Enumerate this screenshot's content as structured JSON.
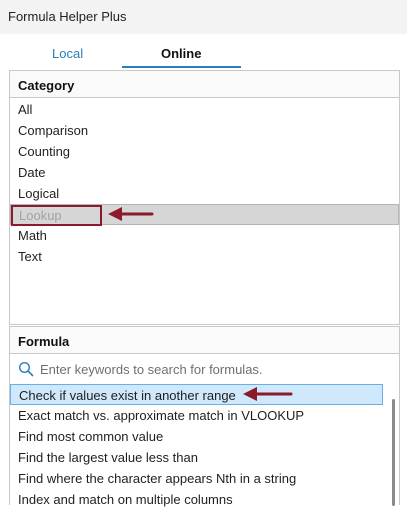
{
  "window": {
    "title": "Formula Helper Plus"
  },
  "tabs": [
    {
      "label": "Local",
      "active": false
    },
    {
      "label": "Online",
      "active": true
    }
  ],
  "category": {
    "header": "Category",
    "items": [
      "All",
      "Comparison",
      "Counting",
      "Date",
      "Logical",
      "Lookup",
      "Math",
      "Text"
    ],
    "selected": "Lookup"
  },
  "formula": {
    "header": "Formula",
    "search_placeholder": "Enter keywords to search for formulas.",
    "items": [
      "Check if values exist in another range",
      "Exact match vs. approximate match in VLOOKUP",
      "Find most common value",
      "Find the largest value less than",
      "Find where the character appears Nth in a string",
      "Index and match on multiple columns"
    ],
    "selected": "Check if values exist in another range"
  },
  "colors": {
    "accent": "#2a7fb8",
    "annotation": "#8b1a2b",
    "selected_formula_bg": "#cfe8fc",
    "selected_category_bg": "#d6d6d6"
  }
}
